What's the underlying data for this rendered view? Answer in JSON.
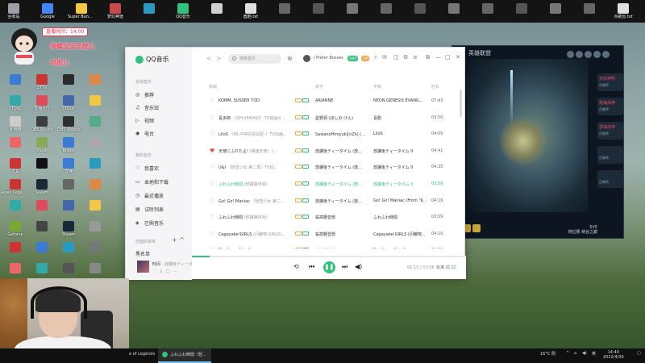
{
  "desktop": {
    "top_icons": [
      "回收站",
      "Google",
      "Super Bunny Man",
      "梦幻神途",
      "",
      "QQ音乐",
      "",
      "酉晒.txt",
      "",
      "",
      "",
      "",
      "",
      "",
      "",
      "",
      "",
      "",
      "点歌台.txt"
    ],
    "note_tag": "直播时间：14:00",
    "red_tags": [
      "海螺宝宝电棍儿",
      "电棍儿"
    ],
    "left_icons": [
      {
        "label": ""
      },
      {
        "label": "ZTTV"
      },
      {
        "label": ""
      },
      {
        "label": ""
      },
      {
        "label": "STO0C"
      },
      {
        "label": "直播大厅"
      },
      {
        "label": "STO0C"
      },
      {
        "label": ""
      },
      {
        "label": "此电脑"
      },
      {
        "label": "OBS Studio"
      },
      {
        "label": "OBS Studio"
      },
      {
        "label": ""
      },
      {
        "label": ""
      },
      {
        "label": "XSplit"
      },
      {
        "label": "Bilibili"
      },
      {
        "label": ""
      },
      {
        "label": "工具"
      },
      {
        "label": ""
      },
      {
        "label": "直播"
      },
      {
        "label": ""
      },
      {
        "label": "Apex Legends"
      },
      {
        "label": "Steam"
      },
      {
        "label": ""
      },
      {
        "label": ""
      },
      {
        "label": ""
      },
      {
        "label": ""
      },
      {
        "label": ""
      },
      {
        "label": ""
      },
      {
        "label": "Geforce"
      },
      {
        "label": ""
      },
      {
        "label": "Steam"
      },
      {
        "label": ""
      },
      {
        "label": ""
      },
      {
        "label": ""
      },
      {
        "label": ""
      },
      {
        "label": ""
      },
      {
        "label": ""
      },
      {
        "label": ""
      },
      {
        "label": ""
      },
      {
        "label": ""
      }
    ]
  },
  "game": {
    "title": "英雄联盟",
    "players": [
      {
        "name": "天际神明",
        "sub": "召唤师"
      },
      {
        "name": "裂魂战神",
        "sub": "召唤师"
      },
      {
        "name": "裂魂战神",
        "sub": "召唤师"
      },
      {
        "name": "",
        "sub": "召唤师"
      },
      {
        "name": "",
        "sub": "召唤师"
      }
    ],
    "status_line1": "5V5",
    "status_line2": "排位赛 峡谷之巅"
  },
  "qqmusic": {
    "app_name": "QQ音乐",
    "side_sections": {
      "online": "在线音乐",
      "mine": "我的音乐",
      "created": "创建的歌单"
    },
    "online_items": [
      "推荐",
      "音乐馆",
      "视频",
      "电台"
    ],
    "mine_items": [
      "我喜欢",
      "本地和下载",
      "最近播放",
      "试听列表",
      "已购音乐"
    ],
    "playlists": [
      "黑名单",
      "Tobu"
    ],
    "search_placeholder": "搜索音乐",
    "user_name": "I Prefer Bosses",
    "badges": [
      "SVIP",
      "VIP"
    ],
    "columns": {
      "title": "歌曲",
      "singer": "歌手",
      "album": "专辑",
      "duration": "时长"
    },
    "songs": [
      {
        "title": "KOMM, SÜSSER TOD",
        "alias": "",
        "singer": "ARIANNE",
        "album": "NEON GENESIS EVANG...",
        "duration": "07:43",
        "liked": false,
        "active": false
      },
      {
        "title": "喜多郎",
        "alias": "（SPY×FAMILY）TV动画片...",
        "singer": "星野源 (ほしの げん)",
        "album": "喜剧",
        "duration": "03:50",
        "liked": false,
        "active": false
      },
      {
        "title": "LiloS",
        "alias": "（86-不存在的战区-）TV动画...",
        "singer": "SawanoHiroyuki[nZk] (泽...",
        "album": "LiloS",
        "duration": "04:05",
        "liked": false,
        "active": false
      },
      {
        "title": "天使にふれたよ!",
        "alias": "(相逢天使)（...",
        "singer": "放課後ティータイム (放...",
        "album": "放課後ティータイム II",
        "duration": "04:41",
        "liked": true,
        "active": false
      },
      {
        "title": "U&I",
        "alias": "（轻音少女 第二季）TV动...",
        "singer": "放課後ティータイム (放...",
        "album": "放課後ティータイム II",
        "duration": "04:35",
        "liked": false,
        "active": false
      },
      {
        "title": "ふわふわ時間",
        "alias": "(轻飘飘时间)",
        "singer": "放課後ティータイム (放...",
        "album": "放課後ティータイム II",
        "duration": "03:56",
        "liked": false,
        "active": true
      },
      {
        "title": "Go! Go! Maniac",
        "alias": "（轻音少女 第二...",
        "singer": "放課後ティータイム (放...",
        "album": "Go! Go! Maniac (From \"K...",
        "duration": "04:16",
        "liked": false,
        "active": false
      },
      {
        "title": "ふわふわ時間",
        "alias": "(轻飘飘时间)",
        "singer": "桜高軽音部",
        "album": "ふわふわ時間",
        "duration": "03:59",
        "liked": false,
        "active": false
      },
      {
        "title": "Cagayake!GIRLS",
        "alias": "(闪耀吧 GIRLS)...",
        "singer": "桜高軽音部",
        "album": "Cagayake!GIRLS (闪耀吧...",
        "duration": "04:10",
        "liked": false,
        "active": false
      },
      {
        "title": "Don't say \"lazy\"",
        "alias": "",
        "singer": "桜高軽音部",
        "album": "Don't say \"lazy\"",
        "duration": "04:21",
        "liked": false,
        "active": false
      }
    ],
    "now_playing": {
      "title": "时间",
      "artist": "放課後ティータ",
      "time": "00:15 / 03:56",
      "quality": "标准",
      "lyrics": "词",
      "count": "52",
      "progress": 0.064
    }
  },
  "taskbar": {
    "game_task": "e of Legends",
    "music_task": "ふわふわ時間（轻...",
    "weather": "16°C 阴",
    "lang": "英",
    "time": "14:40",
    "date": "2022/4/30"
  },
  "colors": {
    "accent": "#31c27c",
    "liked": "#e8474f",
    "vip": "#f0a64a"
  }
}
